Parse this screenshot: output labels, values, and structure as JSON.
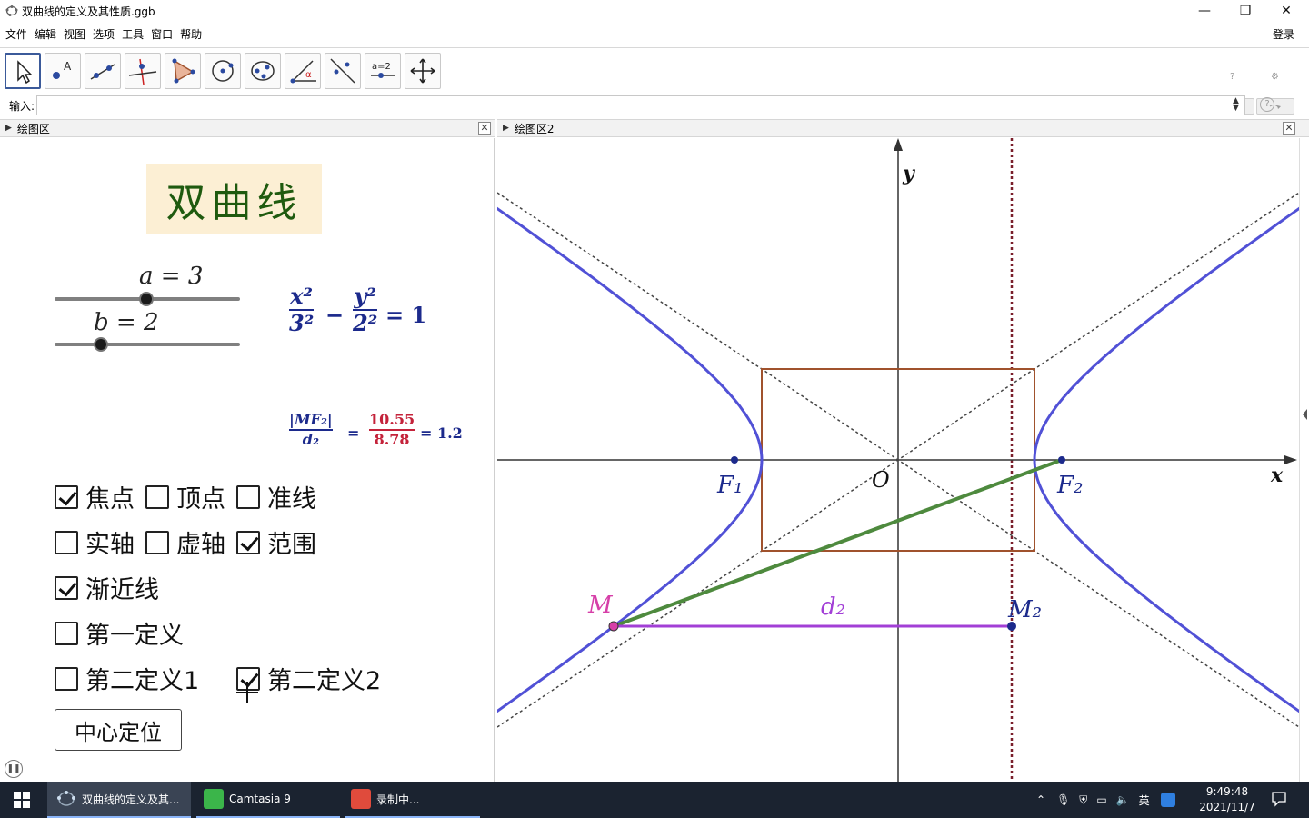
{
  "window": {
    "title": "双曲线的定义及其性质.ggb"
  },
  "menu": {
    "items": [
      "文件",
      "编辑",
      "视图",
      "选项",
      "工具",
      "窗口",
      "帮助"
    ],
    "login": "登录"
  },
  "input_bar": {
    "label": "输入:"
  },
  "panels": {
    "left_title": "绘图区",
    "right_title": "绘图区2"
  },
  "left": {
    "title": "双曲线",
    "slider_a": {
      "label": "a = 3",
      "value": 3
    },
    "slider_b": {
      "label": "b = 2",
      "value": 2
    },
    "equation": {
      "x_num": "x²",
      "x_den": "3²",
      "minus": "−",
      "y_num": "y²",
      "y_den": "2²",
      "rhs": "= 1"
    },
    "ratio": {
      "num": "|MF₂|",
      "den": "d₂",
      "eq1": "=",
      "val_num": "10.55",
      "val_den": "8.78",
      "eq2": "= 1.2"
    },
    "checkboxes": [
      {
        "label": "焦点",
        "checked": true
      },
      {
        "label": "顶点",
        "checked": false
      },
      {
        "label": "准线",
        "checked": false
      },
      {
        "label": "实轴",
        "checked": false
      },
      {
        "label": "虚轴",
        "checked": false
      },
      {
        "label": "范围",
        "checked": true
      },
      {
        "label": "渐近线",
        "checked": true
      },
      {
        "label": "第一定义",
        "checked": false
      },
      {
        "label": "第二定义1",
        "checked": false
      },
      {
        "label": "第二定义2",
        "checked": true
      }
    ],
    "button": "中心定位"
  },
  "graph": {
    "axis_x": "x",
    "axis_y": "y",
    "origin": "O",
    "F1": "F₁",
    "F2": "F₂",
    "M": "M",
    "M2": "M₂",
    "d2": "d₂",
    "colors": {
      "hyperbola": "#5151d6",
      "box": "#a0522d",
      "segment": "#4e8a3e",
      "distance": "#a23fd6",
      "directrix": "#7a1f2b"
    }
  },
  "taskbar": {
    "items": [
      "双曲线的定义及其...",
      "Camtasia 9",
      "录制中..."
    ],
    "ime": "英",
    "time": "9:49:48",
    "date": "2021/11/7"
  }
}
